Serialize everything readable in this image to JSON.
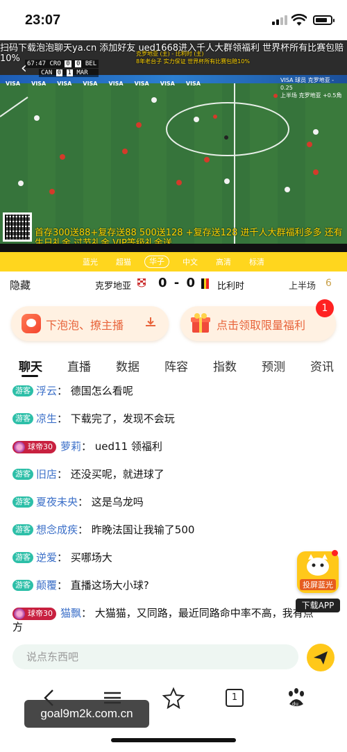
{
  "status_bar": {
    "time": "23:07",
    "battery_level": 0.8
  },
  "video": {
    "marquee_line1": "扫码下载泡泡聊天ya.cn 添加好友 ued1668进入千人大群领福利 世界杯所有比赛包赔",
    "marquee_line2": "10%",
    "scoreboard": {
      "clock": "67:47",
      "match1": {
        "home": "CRO",
        "home_score": "0",
        "away_score": "0",
        "away": "BEL"
      },
      "match2": {
        "home": "CAN",
        "home_score": "0",
        "away_score": "1",
        "away": "MAR"
      }
    },
    "promo_overlay": [
      "克罗地亚 (主) - 比利时 (主)",
      "8年老台子 实力保证 世界杯所有比赛包赔10%"
    ],
    "ad_boards": [
      "VISA",
      "VISA",
      "VISA",
      "VISA",
      "VISA",
      "VISA",
      "VISA",
      "VISA"
    ],
    "right_small": [
      "VISA 球员 克罗地亚 - 0.25",
      "上半场 克罗地亚 +0.5角"
    ],
    "bottom_promo": "首存300送88+复存送88 500送128 +复存送128 进千人大群福利多多 还有生日礼金 过节礼金 VIP等级礼金送"
  },
  "quality": {
    "options": [
      "蓝光",
      "超猫",
      "华子",
      "中文",
      "高清",
      "标清"
    ],
    "selected": "华子"
  },
  "match": {
    "hide_label": "隐藏",
    "home_team": "克罗地亚",
    "score": "0 - 0",
    "away_team": "比利时",
    "period": "上半场",
    "period_num": "6"
  },
  "actions": {
    "download_label": "下泡泡、撩主播",
    "gift_label": "点击领取限量福利",
    "gift_badge": "1"
  },
  "tabs": [
    "聊天",
    "直播",
    "数据",
    "阵容",
    "指数",
    "预测",
    "资讯"
  ],
  "active_tab": "聊天",
  "chat": {
    "guest_tag": "游客",
    "vip_tag": "球帝30",
    "messages": [
      {
        "user": "浮云",
        "text": "德国怎么看呢",
        "role": "guest"
      },
      {
        "user": "凉生",
        "text": "下载完了，发现不会玩",
        "role": "guest"
      },
      {
        "user": "萝莉",
        "text": "ued11 领福利",
        "role": "vip"
      },
      {
        "user": "旧店",
        "text": "还没买呢，就进球了",
        "role": "guest"
      },
      {
        "user": "夏夜未央",
        "text": "这是乌龙吗",
        "role": "guest"
      },
      {
        "user": "想念成疾",
        "text": "昨晚法国让我输了500",
        "role": "guest"
      },
      {
        "user": "逆爱",
        "text": "买哪场大",
        "role": "guest"
      },
      {
        "user": "颠覆",
        "text": "直播这场大小球?",
        "role": "guest"
      },
      {
        "user": "猫飘",
        "text": "大猫猫，又同路，最近同路命中率不高，我有点方",
        "role": "vip"
      }
    ]
  },
  "float_app": {
    "cast_label": "投屏蓝光",
    "download_label": "下载APP"
  },
  "input": {
    "placeholder": "说点东西吧"
  },
  "browser": {
    "tab_count": "1",
    "baidu_label": "du"
  },
  "watermark": "goal9m2k.com.cn",
  "colors": {
    "accent_yellow": "#ffd61e",
    "guest_tag": "#2dbfa8",
    "vip_tag": "#c8203f",
    "username": "#3b6fc8",
    "action_text": "#e8643b"
  }
}
